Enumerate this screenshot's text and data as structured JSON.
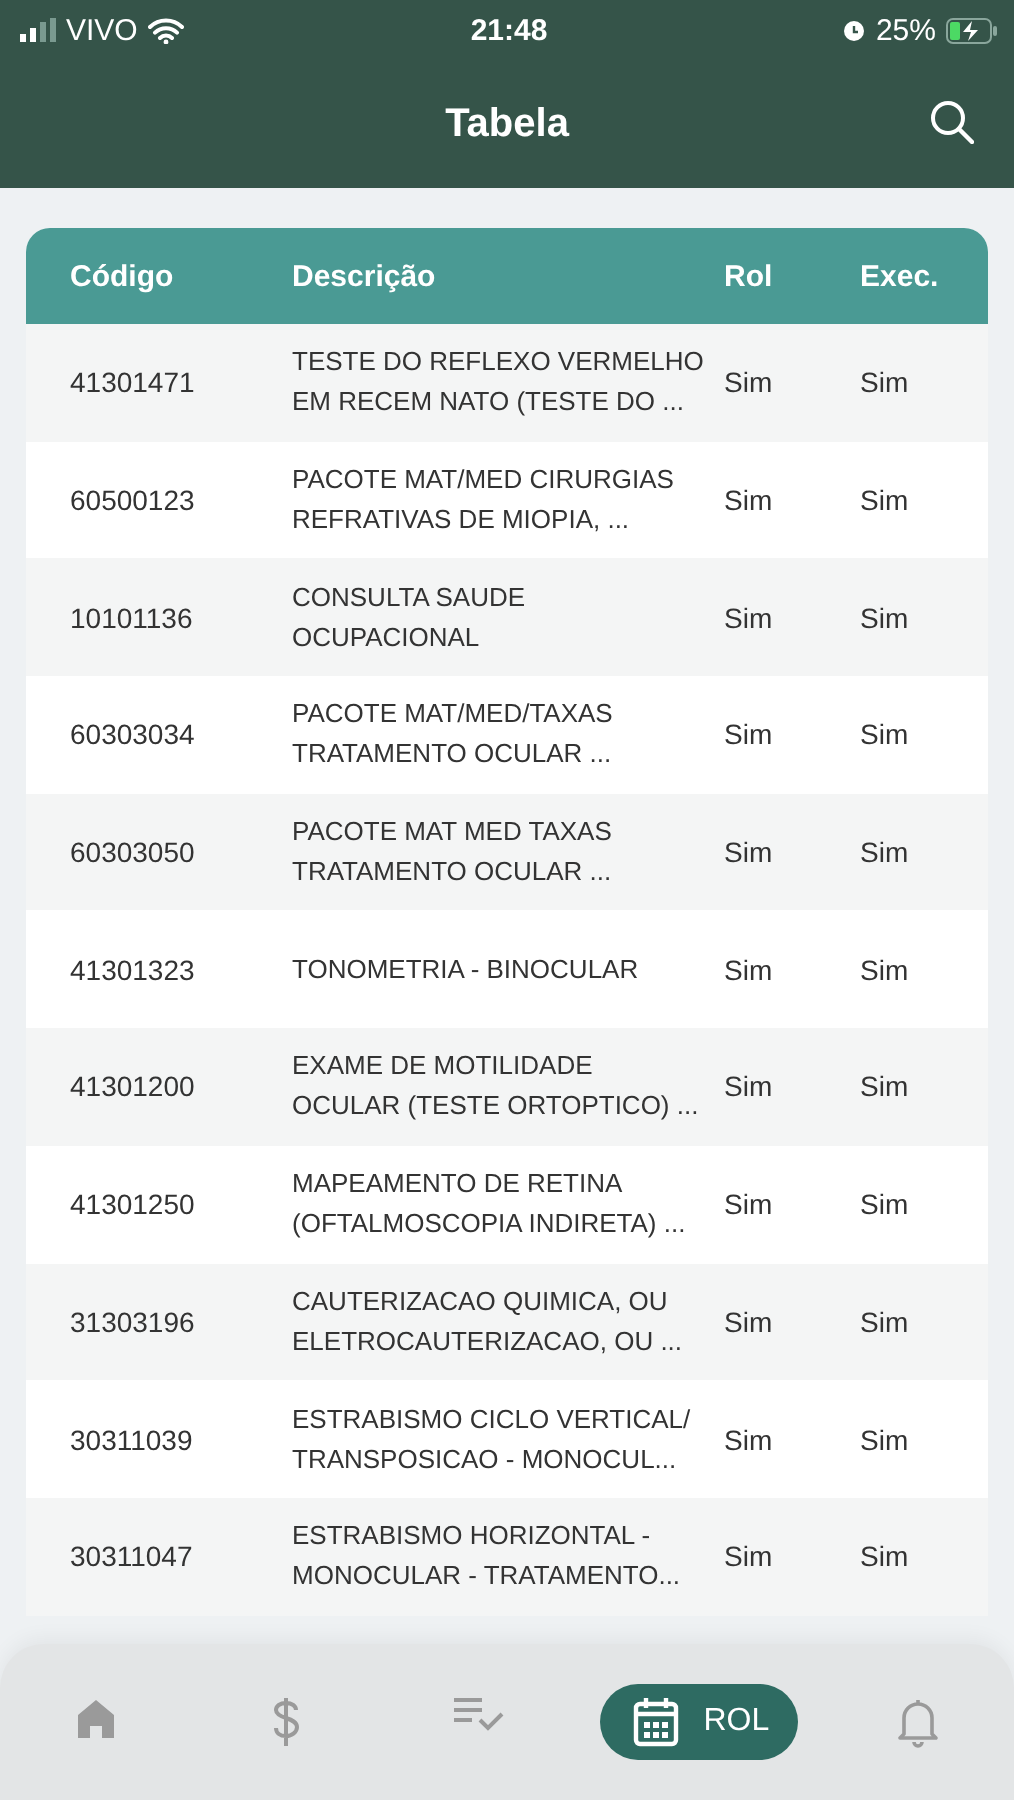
{
  "status_bar": {
    "carrier": "VIVO",
    "time": "21:48",
    "battery": "25%"
  },
  "header": {
    "title": "Tabela"
  },
  "table": {
    "columns": [
      "Código",
      "Descrição",
      "Rol",
      "Exec."
    ],
    "rows": [
      {
        "code": "41301471",
        "description": [
          "TESTE DO REFLEXO VERMELHO",
          "EM RECEM NATO (TESTE DO ..."
        ],
        "rol": "Sim",
        "exec": "Sim"
      },
      {
        "code": "60500123",
        "description": [
          "PACOTE MAT/MED CIRURGIAS",
          "REFRATIVAS DE MIOPIA, ..."
        ],
        "rol": "Sim",
        "exec": "Sim"
      },
      {
        "code": "10101136",
        "description": [
          "CONSULTA SAUDE",
          "OCUPACIONAL"
        ],
        "rol": "Sim",
        "exec": "Sim"
      },
      {
        "code": "60303034",
        "description": [
          "PACOTE MAT/MED/TAXAS",
          "TRATAMENTO OCULAR ..."
        ],
        "rol": "Sim",
        "exec": "Sim"
      },
      {
        "code": "60303050",
        "description": [
          "PACOTE MAT MED TAXAS",
          "TRATAMENTO OCULAR ..."
        ],
        "rol": "Sim",
        "exec": "Sim"
      },
      {
        "code": "41301323",
        "description": [
          "TONOMETRIA - BINOCULAR"
        ],
        "rol": "Sim",
        "exec": "Sim"
      },
      {
        "code": "41301200",
        "description": [
          "EXAME DE MOTILIDADE",
          "OCULAR (TESTE ORTOPTICO) ..."
        ],
        "rol": "Sim",
        "exec": "Sim"
      },
      {
        "code": "41301250",
        "description": [
          "MAPEAMENTO DE RETINA",
          "(OFTALMOSCOPIA INDIRETA) ..."
        ],
        "rol": "Sim",
        "exec": "Sim"
      },
      {
        "code": "31303196",
        "description": [
          "CAUTERIZACAO QUIMICA, OU",
          "ELETROCAUTERIZACAO, OU ..."
        ],
        "rol": "Sim",
        "exec": "Sim"
      },
      {
        "code": "30311039",
        "description": [
          "ESTRABISMO CICLO VERTICAL/",
          "TRANSPOSICAO - MONOCUL..."
        ],
        "rol": "Sim",
        "exec": "Sim"
      },
      {
        "code": "30311047",
        "description": [
          "ESTRABISMO HORIZONTAL -",
          "MONOCULAR - TRATAMENTO..."
        ],
        "rol": "Sim",
        "exec": "Sim"
      }
    ]
  },
  "nav": [
    {
      "kind": "home",
      "selected": false
    },
    {
      "kind": "dollar",
      "selected": false
    },
    {
      "kind": "checklist",
      "selected": false
    },
    {
      "kind": "calendar",
      "selected": true,
      "label": "ROL"
    },
    {
      "kind": "bell",
      "selected": false
    }
  ]
}
